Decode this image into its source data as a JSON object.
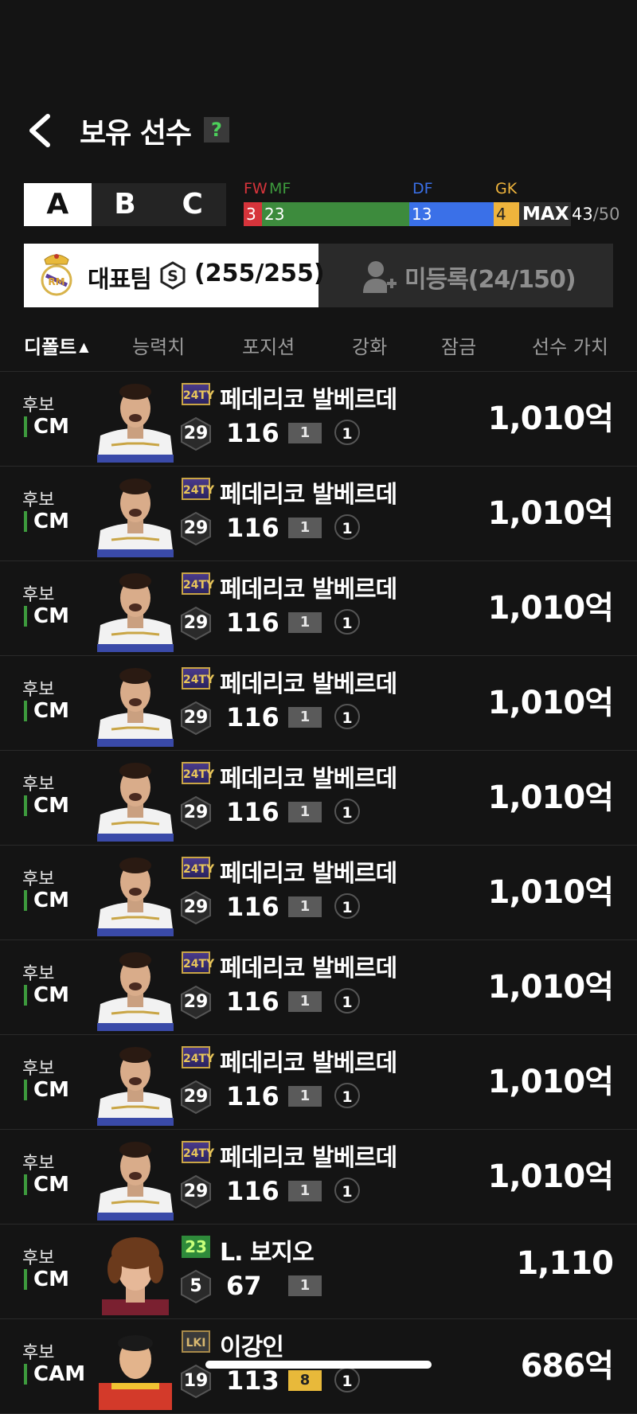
{
  "header": {
    "title": "보유 선수",
    "help": "?"
  },
  "squads": [
    "A",
    "B",
    "C"
  ],
  "positions": {
    "fw_label": "FW",
    "mf_label": "MF",
    "df_label": "DF",
    "gk_label": "GK",
    "fw": "3",
    "mf": "23",
    "df": "13",
    "gk": "4",
    "max_label": "MAX",
    "current": "43",
    "max": "/50",
    "colors": {
      "fw": "#d6343b",
      "mf": "#3d8b3d",
      "df": "#3a70e8",
      "gk": "#efb43c"
    }
  },
  "team": {
    "main_label": "대표팀",
    "main_count": "(255/255)",
    "unreg_label": "미등록(24/150)"
  },
  "sort": [
    "디폴트",
    "능력치",
    "포지션",
    "강화",
    "잠금",
    "선수 가치"
  ],
  "players": [
    {
      "status": "후보",
      "position": "CM",
      "season": "24TY",
      "name": "페데리코 발베르데",
      "level": "29",
      "ovr": "116",
      "enh": "1",
      "lock": "1",
      "value": "1,010억"
    },
    {
      "status": "후보",
      "position": "CM",
      "season": "24TY",
      "name": "페데리코 발베르데",
      "level": "29",
      "ovr": "116",
      "enh": "1",
      "lock": "1",
      "value": "1,010억"
    },
    {
      "status": "후보",
      "position": "CM",
      "season": "24TY",
      "name": "페데리코 발베르데",
      "level": "29",
      "ovr": "116",
      "enh": "1",
      "lock": "1",
      "value": "1,010억"
    },
    {
      "status": "후보",
      "position": "CM",
      "season": "24TY",
      "name": "페데리코 발베르데",
      "level": "29",
      "ovr": "116",
      "enh": "1",
      "lock": "1",
      "value": "1,010억"
    },
    {
      "status": "후보",
      "position": "CM",
      "season": "24TY",
      "name": "페데리코 발베르데",
      "level": "29",
      "ovr": "116",
      "enh": "1",
      "lock": "1",
      "value": "1,010억"
    },
    {
      "status": "후보",
      "position": "CM",
      "season": "24TY",
      "name": "페데리코 발베르데",
      "level": "29",
      "ovr": "116",
      "enh": "1",
      "lock": "1",
      "value": "1,010억"
    },
    {
      "status": "후보",
      "position": "CM",
      "season": "24TY",
      "name": "페데리코 발베르데",
      "level": "29",
      "ovr": "116",
      "enh": "1",
      "lock": "1",
      "value": "1,010억"
    },
    {
      "status": "후보",
      "position": "CM",
      "season": "24TY",
      "name": "페데리코 발베르데",
      "level": "29",
      "ovr": "116",
      "enh": "1",
      "lock": "1",
      "value": "1,010억"
    },
    {
      "status": "후보",
      "position": "CM",
      "season": "24TY",
      "name": "페데리코 발베르데",
      "level": "29",
      "ovr": "116",
      "enh": "1",
      "lock": "1",
      "value": "1,010억"
    },
    {
      "status": "후보",
      "position": "CM",
      "season": "23",
      "name": "L. 보지오",
      "level": "5",
      "ovr": "67",
      "enh": "1",
      "lock": "",
      "value": "1,110"
    },
    {
      "status": "후보",
      "position": "CAM",
      "season": "LKI",
      "name": "이강인",
      "level": "19",
      "ovr": "113",
      "enh": "8",
      "lock": "1",
      "value": "686억"
    }
  ]
}
